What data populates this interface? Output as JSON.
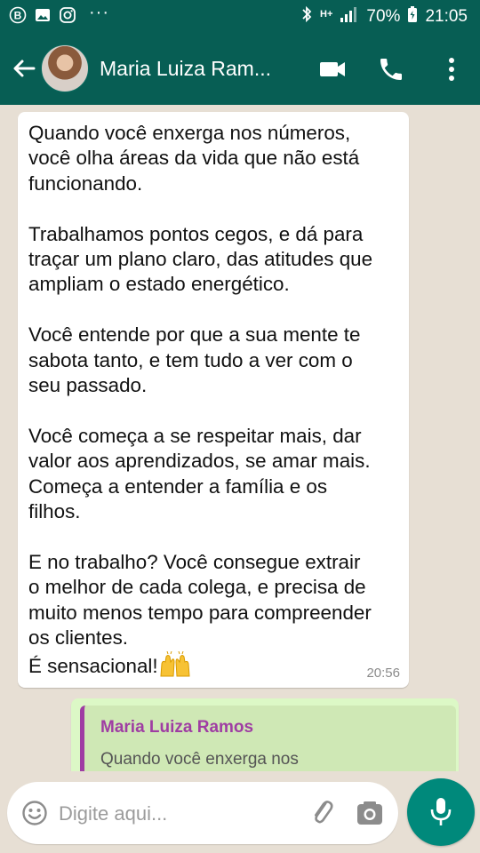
{
  "status_bar": {
    "battery": "70%",
    "time": "21:05",
    "network": "H+"
  },
  "header": {
    "contact_name": "Maria Luiza Ram..."
  },
  "messages": [
    {
      "direction": "incoming",
      "text": "Quando você enxerga nos números,\nvocê olha áreas da vida que não está\nfuncionando.\n\nTrabalhamos pontos cegos, e dá para\ntraçar um plano claro, das atitudes que\nampliam o estado energético.\n\nVocê entende por que a sua mente te\nsabota tanto, e tem tudo a ver com o\nseu passado.\n\nVocê começa a se respeitar mais, dar\nvalor aos aprendizados, se amar mais.\nComeça a entender a família e os\nfilhos.\n\nE no trabalho? Você consegue extrair\no melhor de cada colega, e precisa de\nmuito menos tempo para compreender\nos clientes.\nÉ sensacional!",
      "emoji": "raising-hands",
      "time": "20:56"
    },
    {
      "direction": "outgoing",
      "quote_name": "Maria Luiza Ramos",
      "quote_text": "Quando você enxerga nos números, você olha áreas da"
    }
  ],
  "composer": {
    "placeholder": "Digite aqui..."
  },
  "colors": {
    "header": "#075e54",
    "chat_background": "#e7dfd4",
    "outgoing_bubble": "#dcf8c6",
    "quote_accent": "#9f3da3",
    "mic_button": "#00897b"
  }
}
